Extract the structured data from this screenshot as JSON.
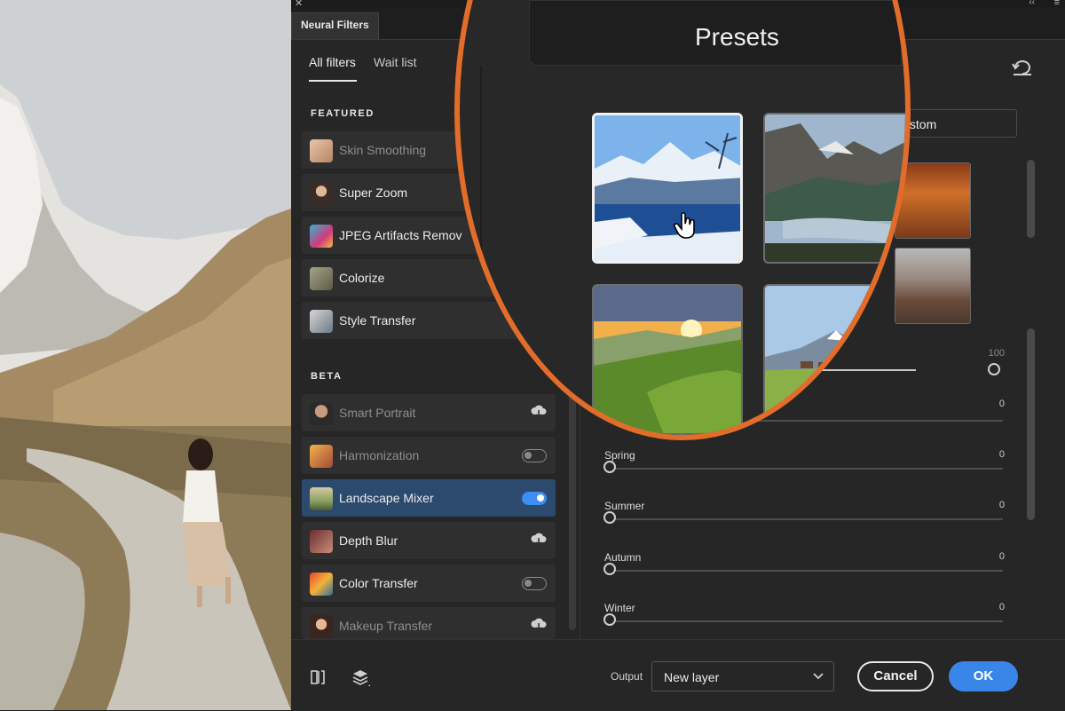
{
  "window": {
    "panel_title": "Neural Filters"
  },
  "tabs": [
    {
      "label": "All filters"
    },
    {
      "label": "Wait list"
    }
  ],
  "sections": {
    "featured": "FEATURED",
    "beta": "BETA"
  },
  "featured_filters": [
    {
      "label": "Skin Smoothing",
      "icon": "face-thumb-icon"
    },
    {
      "label": "Super Zoom",
      "icon": "portrait-glasses-thumb-icon"
    },
    {
      "label": "JPEG Artifacts Remov",
      "icon": "jpeg-artifacts-thumb-icon"
    },
    {
      "label": "Colorize",
      "icon": "colorize-thumb-icon"
    },
    {
      "label": "Style Transfer",
      "icon": "style-transfer-thumb-icon"
    }
  ],
  "beta_filters": [
    {
      "label": "Smart Portrait",
      "icon": "smart-portrait-thumb-icon",
      "control": "cloud-download-icon"
    },
    {
      "label": "Harmonization",
      "icon": "harmonization-thumb-icon",
      "control": "toggle-off"
    },
    {
      "label": "Landscape Mixer",
      "icon": "landscape-mixer-thumb-icon",
      "control": "toggle-on"
    },
    {
      "label": "Depth Blur",
      "icon": "depth-blur-thumb-icon",
      "control": "cloud-download-icon"
    },
    {
      "label": "Color Transfer",
      "icon": "color-transfer-thumb-icon",
      "control": "toggle-off"
    },
    {
      "label": "Makeup Transfer",
      "icon": "makeup-transfer-thumb-icon",
      "control": "cloud-download-icon"
    }
  ],
  "presets": {
    "title": "Presets",
    "custom_label": "Custom"
  },
  "sliders": [
    {
      "name": "",
      "value": "100"
    },
    {
      "name": "",
      "value": "0"
    },
    {
      "name": "Spring",
      "value": "0"
    },
    {
      "name": "Summer",
      "value": "0"
    },
    {
      "name": "Autumn",
      "value": "0"
    },
    {
      "name": "Winter",
      "value": "0"
    }
  ],
  "footer": {
    "output_label": "Output",
    "output_value": "New layer",
    "cancel_label": "Cancel",
    "ok_label": "OK"
  },
  "colors": {
    "accent": "#3a86e8",
    "magnifier_ring": "#e26d2b",
    "selected_row": "#2c4a6e"
  }
}
